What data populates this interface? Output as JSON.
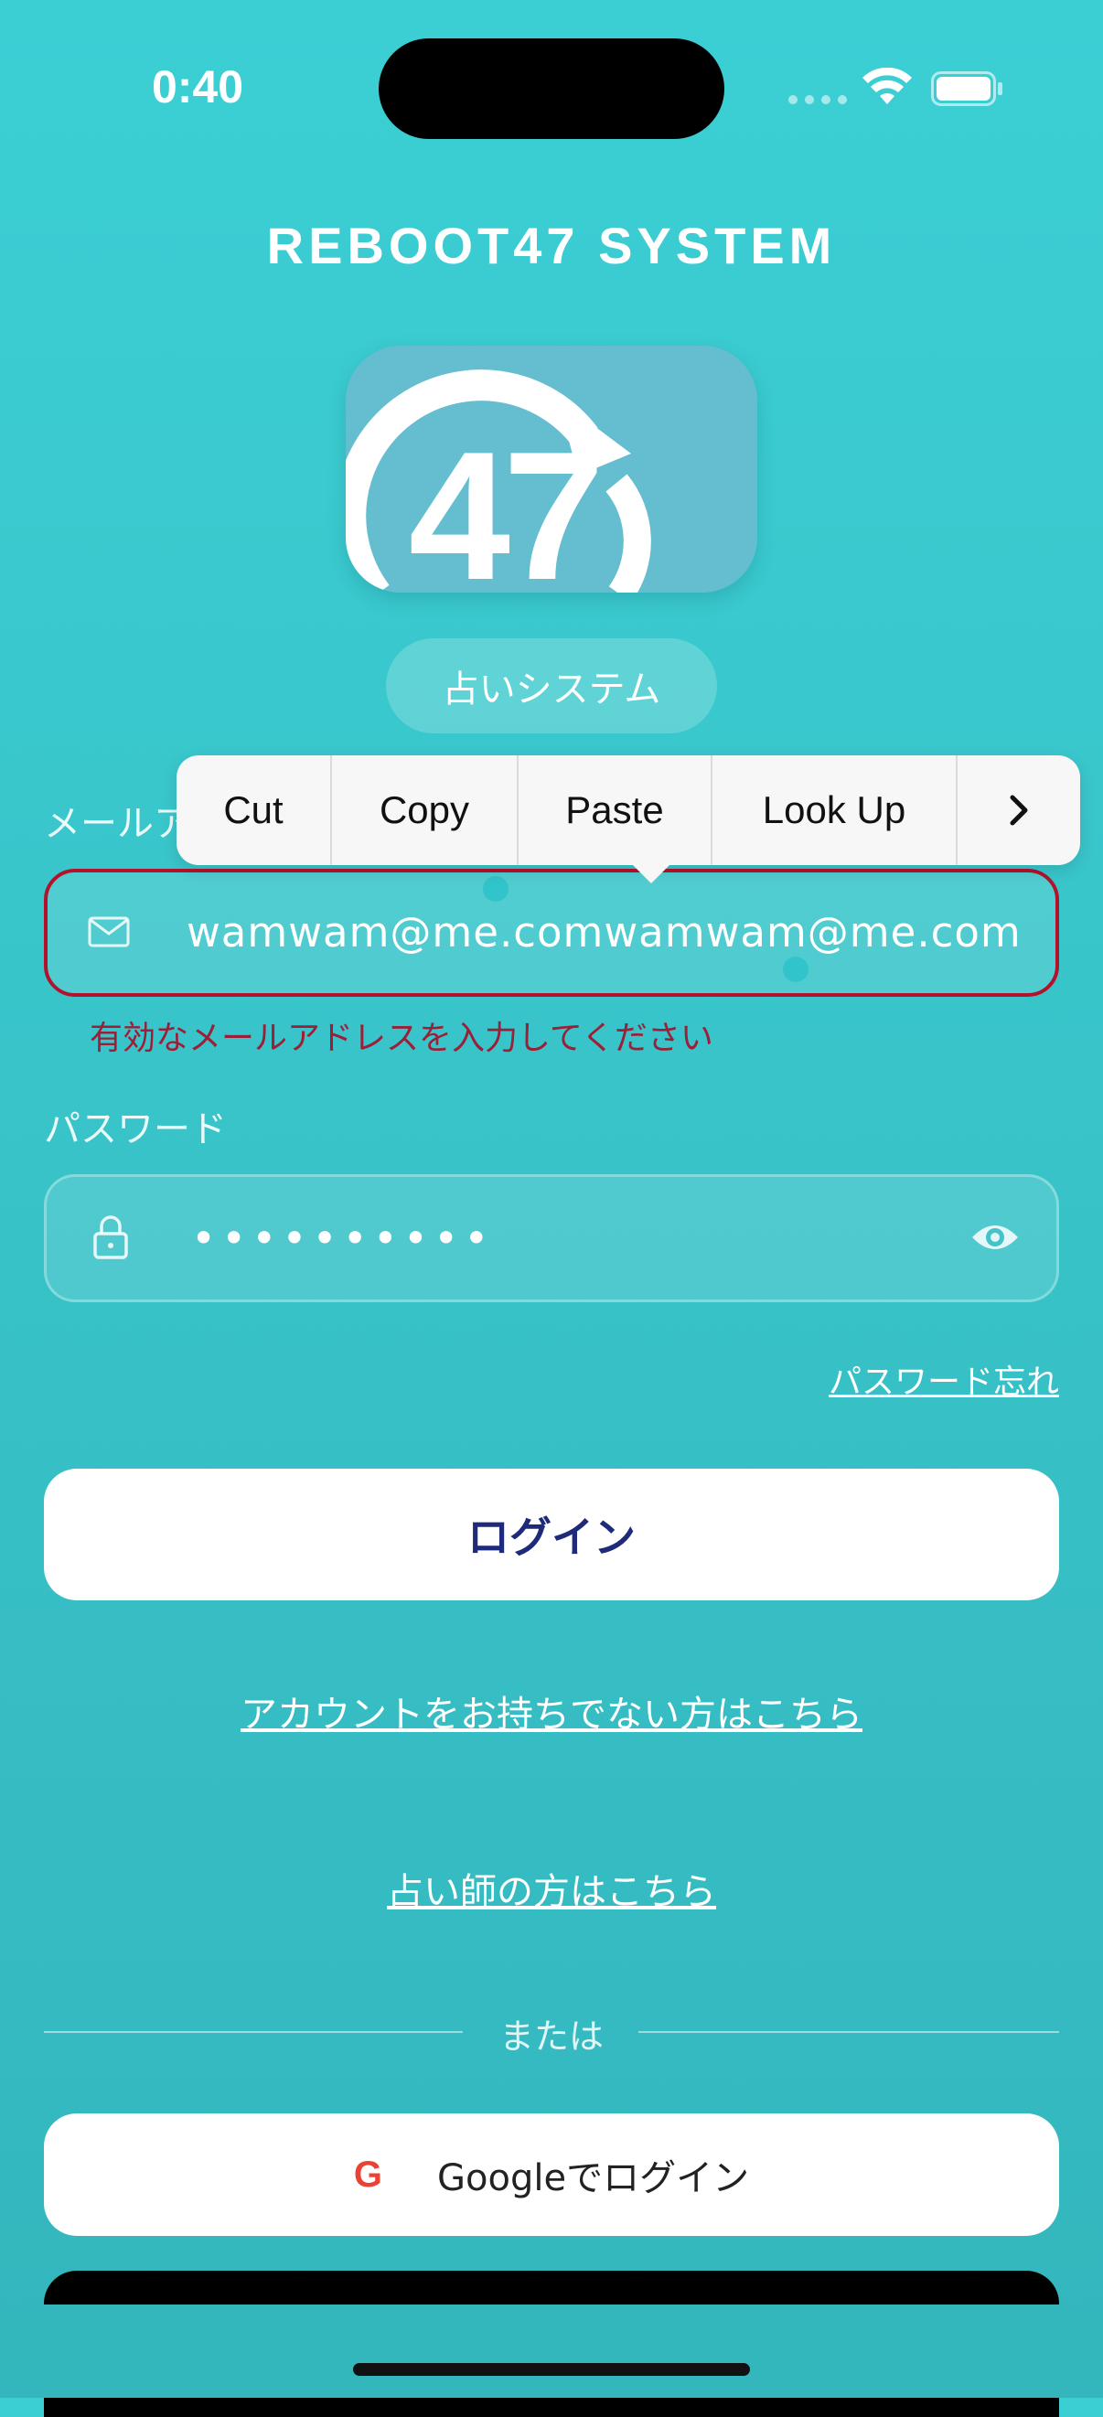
{
  "status_bar": {
    "time": "0:40"
  },
  "app": {
    "title": "REBOOT47 SYSTEM",
    "logo_text": "47",
    "subtitle": "占いシステム"
  },
  "context_menu": {
    "items": [
      "Cut",
      "Copy",
      "Paste",
      "Look Up"
    ],
    "more_icon": "chevron-right-icon"
  },
  "email": {
    "label": "メールアドレス",
    "value": "wamwam@me.comwamwam@me.com",
    "error": "有効なメールアドレスを入力してください",
    "icon": "mail-icon"
  },
  "password": {
    "label": "パスワード",
    "value": "••••••••••",
    "icon": "lock-icon",
    "toggle_icon": "eye-icon"
  },
  "links": {
    "forgot": "パスワード忘れ",
    "signup": "アカウントをお持ちでない方はこちら",
    "fortune_teller": "占い師の方はこちら"
  },
  "buttons": {
    "login": "ログイン",
    "google": "Googleでログイン",
    "google_icon_letter": "G"
  },
  "divider": {
    "text": "または"
  },
  "colors": {
    "accent": "#38c9ce",
    "error": "#b3122c",
    "login_text": "#1e2a7a",
    "google_red": "#ea4335"
  }
}
